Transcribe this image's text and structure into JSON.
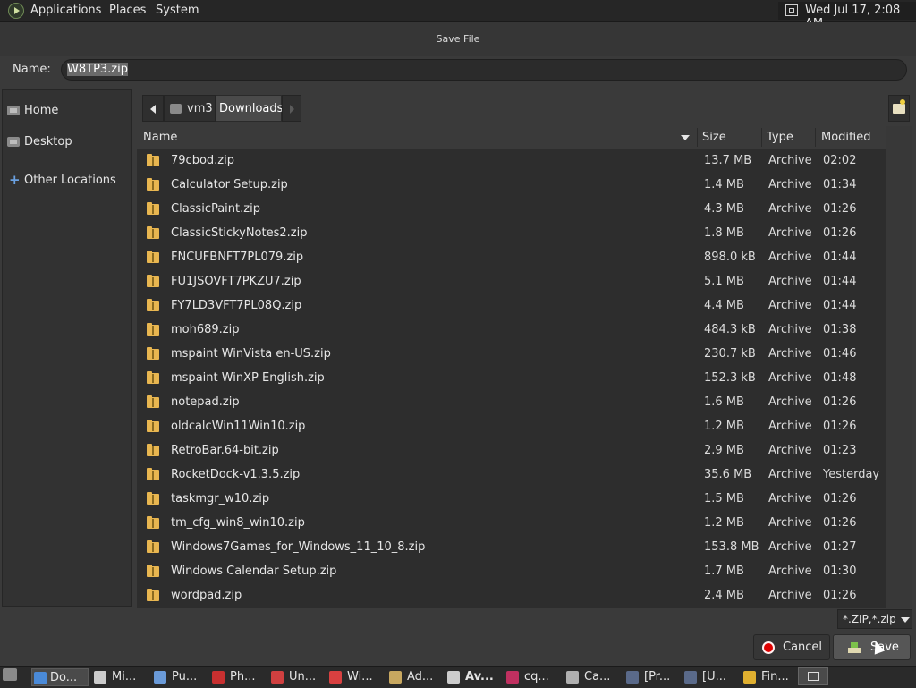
{
  "top_panel": {
    "menus": [
      "Applications",
      "Places",
      "System"
    ],
    "clock": "Wed Jul 17,  2:08 AM"
  },
  "dialog": {
    "title": "Save File",
    "name_label": "Name:",
    "name_value": "W8TP3.zip",
    "sidebar": [
      {
        "label": "Home",
        "icon": "home-folder-icon"
      },
      {
        "label": "Desktop",
        "icon": "desktop-folder-icon"
      },
      {
        "label": "Other Locations",
        "icon": "plus-icon"
      }
    ],
    "path": [
      "vm3",
      "Downloads"
    ],
    "columns": {
      "name": "Name",
      "size": "Size",
      "type": "Type",
      "modified": "Modified"
    },
    "files": [
      {
        "name": "79cbod.zip",
        "size": "13.7 MB",
        "type": "Archive",
        "modified": "02:02"
      },
      {
        "name": "Calculator Setup.zip",
        "size": "1.4 MB",
        "type": "Archive",
        "modified": "01:34"
      },
      {
        "name": "ClassicPaint.zip",
        "size": "4.3 MB",
        "type": "Archive",
        "modified": "01:26"
      },
      {
        "name": "ClassicStickyNotes2.zip",
        "size": "1.8 MB",
        "type": "Archive",
        "modified": "01:26"
      },
      {
        "name": "FNCUFBNFT7PL079.zip",
        "size": "898.0 kB",
        "type": "Archive",
        "modified": "01:44"
      },
      {
        "name": "FU1JSOVFT7PKZU7.zip",
        "size": "5.1 MB",
        "type": "Archive",
        "modified": "01:44"
      },
      {
        "name": "FY7LD3VFT7PL08Q.zip",
        "size": "4.4 MB",
        "type": "Archive",
        "modified": "01:44"
      },
      {
        "name": "moh689.zip",
        "size": "484.3 kB",
        "type": "Archive",
        "modified": "01:38"
      },
      {
        "name": "mspaint WinVista en-US.zip",
        "size": "230.7 kB",
        "type": "Archive",
        "modified": "01:46"
      },
      {
        "name": "mspaint WinXP English.zip",
        "size": "152.3 kB",
        "type": "Archive",
        "modified": "01:48"
      },
      {
        "name": "notepad.zip",
        "size": "1.6 MB",
        "type": "Archive",
        "modified": "01:26"
      },
      {
        "name": "oldcalcWin11Win10.zip",
        "size": "1.2 MB",
        "type": "Archive",
        "modified": "01:26"
      },
      {
        "name": "RetroBar.64-bit.zip",
        "size": "2.9 MB",
        "type": "Archive",
        "modified": "01:23"
      },
      {
        "name": "RocketDock-v1.3.5.zip",
        "size": "35.6 MB",
        "type": "Archive",
        "modified": "Yesterday"
      },
      {
        "name": "taskmgr_w10.zip",
        "size": "1.5 MB",
        "type": "Archive",
        "modified": "01:26"
      },
      {
        "name": "tm_cfg_win8_win10.zip",
        "size": "1.2 MB",
        "type": "Archive",
        "modified": "01:26"
      },
      {
        "name": "Windows7Games_for_Windows_11_10_8.zip",
        "size": "153.8 MB",
        "type": "Archive",
        "modified": "01:27"
      },
      {
        "name": "Windows Calendar Setup.zip",
        "size": "1.7 MB",
        "type": "Archive",
        "modified": "01:30"
      },
      {
        "name": "wordpad.zip",
        "size": "2.4 MB",
        "type": "Archive",
        "modified": "01:26"
      }
    ],
    "filter": "*.ZIP,*.zip",
    "cancel_label": "Cancel",
    "save_label": "Save"
  },
  "taskbar": {
    "tasks": [
      {
        "label": "Do...",
        "icon": "chrome-icon",
        "color": "#4a8ad8",
        "active": true
      },
      {
        "label": "Mi...",
        "icon": "gear-icon",
        "color": "#cccccc"
      },
      {
        "label": "Pu...",
        "icon": "glasses-icon",
        "color": "#6a9ad8"
      },
      {
        "label": "Ph...",
        "icon": "pdf-icon",
        "color": "#c83030"
      },
      {
        "label": "Un...",
        "icon": "screenshot-icon",
        "color": "#d04040"
      },
      {
        "label": "Wi...",
        "icon": "window-icon",
        "color": "#d84040"
      },
      {
        "label": "Ad...",
        "icon": "notebook-icon",
        "color": "#c8a860"
      },
      {
        "label": "Av...",
        "icon": "tag-icon",
        "color": "#cccccc",
        "bold": true
      },
      {
        "label": "cq...",
        "icon": "grid-icon",
        "color": "#c03060"
      },
      {
        "label": "Ca...",
        "icon": "palette-icon",
        "color": "#b0b0b0"
      },
      {
        "label": "[Pr...",
        "icon": "monitor-icon",
        "color": "#5a6a8a"
      },
      {
        "label": "[U...",
        "icon": "monitor-icon",
        "color": "#5a6a8a"
      },
      {
        "label": "Fin...",
        "icon": "search-window-icon",
        "color": "#e0b030"
      }
    ]
  },
  "colors": {
    "accent": "#e8b650",
    "cancel": "#dd0000",
    "save_icon": "#7cc04a"
  }
}
